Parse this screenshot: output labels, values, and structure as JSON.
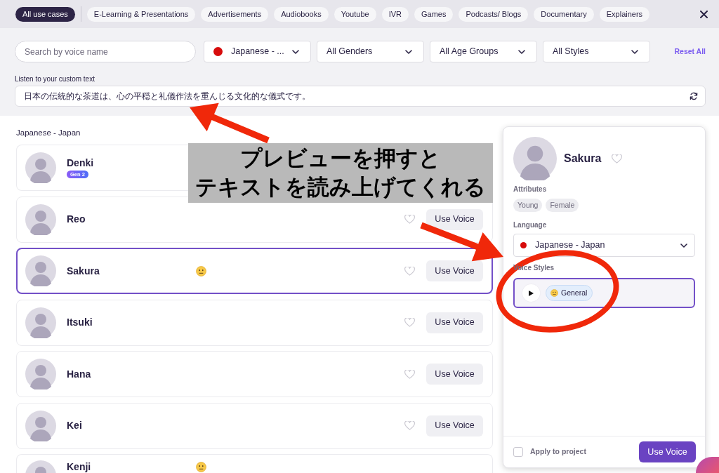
{
  "use_case_tabs": [
    {
      "label": "All use cases",
      "selected": true
    },
    {
      "label": "E-Learning & Presentations",
      "selected": false
    },
    {
      "label": "Advertisements",
      "selected": false
    },
    {
      "label": "Audiobooks",
      "selected": false
    },
    {
      "label": "Youtube",
      "selected": false
    },
    {
      "label": "IVR",
      "selected": false
    },
    {
      "label": "Games",
      "selected": false
    },
    {
      "label": "Podcasts/ Blogs",
      "selected": false
    },
    {
      "label": "Documentary",
      "selected": false
    },
    {
      "label": "Explainers",
      "selected": false
    }
  ],
  "filters": {
    "search": {
      "placeholder": "Search by voice name"
    },
    "dropdowns": [
      {
        "kind": "language",
        "label": "Japanese - ..."
      },
      {
        "kind": "plain",
        "label": "All Genders"
      },
      {
        "kind": "plain",
        "label": "All Age Groups"
      },
      {
        "kind": "plain",
        "label": "All Styles"
      }
    ],
    "reset": "Reset All"
  },
  "custom_text": {
    "label": "Listen to your custom text",
    "value": "日本の伝統的な茶道は、心の平穏と礼儀作法を重んじる文化的な儀式です。"
  },
  "voice_list": {
    "heading": "Japanese - Japan",
    "voices": [
      {
        "name": "Denki",
        "badge": "Gen 2",
        "style_icon": false,
        "selected": false
      },
      {
        "name": "Reo",
        "style_icon": false,
        "selected": false,
        "button": "Use Voice"
      },
      {
        "name": "Sakura",
        "style_icon": true,
        "selected": true,
        "button": "Use Voice"
      },
      {
        "name": "Itsuki",
        "style_icon": false,
        "selected": false,
        "button": "Use Voice"
      },
      {
        "name": "Hana",
        "style_icon": false,
        "selected": false,
        "button": "Use Voice"
      },
      {
        "name": "Kei",
        "style_icon": false,
        "selected": false,
        "button": "Use Voice"
      },
      {
        "name": "Kenji",
        "style_icon": true,
        "selected": false
      }
    ]
  },
  "detail_panel": {
    "name": "Sakura",
    "attributes_label": "Attributes",
    "attributes": [
      "Young",
      "Female"
    ],
    "language_label": "Language",
    "language": "Japanese - Japan",
    "styles_label": "Voice Styles",
    "styles": [
      {
        "label": "General",
        "selected": true
      }
    ],
    "apply_label": "Apply to project",
    "apply_checked": false,
    "button": "Use Voice"
  },
  "annotation": {
    "lines": [
      "プレビューを押すと",
      "テキストを読み上げてくれる"
    ]
  }
}
